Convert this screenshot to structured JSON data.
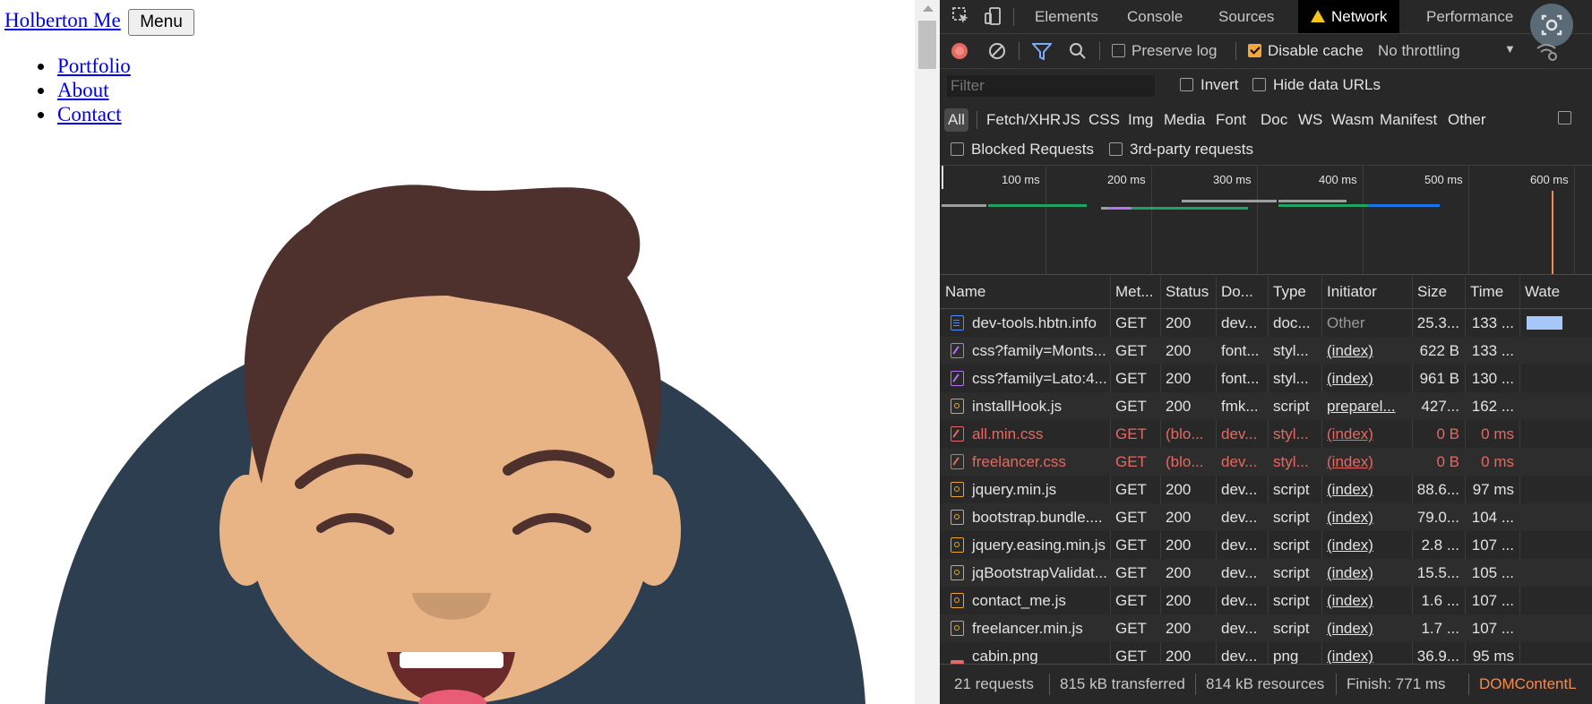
{
  "page": {
    "brand": "Holberton Me",
    "menu_button": "Menu",
    "nav": [
      "Portfolio",
      "About",
      "Contact"
    ]
  },
  "devtools": {
    "tabs": [
      "Elements",
      "Console",
      "Sources",
      "Network",
      "Performance"
    ],
    "active_tab": "Network",
    "toolbar": {
      "preserve_log": "Preserve log",
      "disable_cache": "Disable cache",
      "throttling": "No throttling",
      "preserve_log_checked": false,
      "disable_cache_checked": true
    },
    "filter": {
      "placeholder": "Filter",
      "invert": "Invert",
      "hide_data_urls": "Hide data URLs"
    },
    "type_filters": [
      "All",
      "Fetch/XHR",
      "JS",
      "CSS",
      "Img",
      "Media",
      "Font",
      "Doc",
      "WS",
      "Wasm",
      "Manifest",
      "Other"
    ],
    "blocked_requests": "Blocked Requests",
    "third_party": "3rd-party requests",
    "timeline_ticks": [
      "100 ms",
      "200 ms",
      "300 ms",
      "400 ms",
      "500 ms",
      "600 ms"
    ],
    "columns": [
      "Name",
      "Met...",
      "Status",
      "Do...",
      "Type",
      "Initiator",
      "Size",
      "Time",
      "Wate"
    ],
    "rows": [
      {
        "icon": "doc",
        "name": "dev-tools.hbtn.info",
        "method": "GET",
        "status": "200",
        "domain": "dev...",
        "type": "doc...",
        "initiator": "Other",
        "size": "25.3...",
        "time": "133 ...",
        "err": false,
        "link": false
      },
      {
        "icon": "css",
        "name": "css?family=Monts...",
        "method": "GET",
        "status": "200",
        "domain": "font...",
        "type": "styl...",
        "initiator": "(index)",
        "size": "622 B",
        "time": "133 ...",
        "err": false,
        "link": true
      },
      {
        "icon": "css",
        "name": "css?family=Lato:4...",
        "method": "GET",
        "status": "200",
        "domain": "font...",
        "type": "styl...",
        "initiator": "(index)",
        "size": "961 B",
        "time": "130 ...",
        "err": false,
        "link": true
      },
      {
        "icon": "js",
        "name": "installHook.js",
        "method": "GET",
        "status": "200",
        "domain": "fmk...",
        "type": "script",
        "initiator": "preparel...",
        "size": "427...",
        "time": "162 ...",
        "err": false,
        "link": true
      },
      {
        "icon": "err",
        "name": "all.min.css",
        "method": "GET",
        "status": "(blo...",
        "domain": "dev...",
        "type": "styl...",
        "initiator": "(index)",
        "size": "0 B",
        "time": "0 ms",
        "err": true,
        "link": true
      },
      {
        "icon": "err",
        "name": "freelancer.css",
        "method": "GET",
        "status": "(blo...",
        "domain": "dev...",
        "type": "styl...",
        "initiator": "(index)",
        "size": "0 B",
        "time": "0 ms",
        "err": true,
        "link": true
      },
      {
        "icon": "js",
        "name": "jquery.min.js",
        "method": "GET",
        "status": "200",
        "domain": "dev...",
        "type": "script",
        "initiator": "(index)",
        "size": "88.6...",
        "time": "97 ms",
        "err": false,
        "link": true
      },
      {
        "icon": "js",
        "name": "bootstrap.bundle....",
        "method": "GET",
        "status": "200",
        "domain": "dev...",
        "type": "script",
        "initiator": "(index)",
        "size": "79.0...",
        "time": "104 ...",
        "err": false,
        "link": true
      },
      {
        "icon": "js",
        "name": "jquery.easing.min.js",
        "method": "GET",
        "status": "200",
        "domain": "dev...",
        "type": "script",
        "initiator": "(index)",
        "size": "2.8 ...",
        "time": "107 ...",
        "err": false,
        "link": true
      },
      {
        "icon": "js",
        "name": "jqBootstrapValidat...",
        "method": "GET",
        "status": "200",
        "domain": "dev...",
        "type": "script",
        "initiator": "(index)",
        "size": "15.5...",
        "time": "105 ...",
        "err": false,
        "link": true
      },
      {
        "icon": "js",
        "name": "contact_me.js",
        "method": "GET",
        "status": "200",
        "domain": "dev...",
        "type": "script",
        "initiator": "(index)",
        "size": "1.6 ...",
        "time": "107 ...",
        "err": false,
        "link": true
      },
      {
        "icon": "js",
        "name": "freelancer.min.js",
        "method": "GET",
        "status": "200",
        "domain": "dev...",
        "type": "script",
        "initiator": "(index)",
        "size": "1.7 ...",
        "time": "107 ...",
        "err": false,
        "link": true
      },
      {
        "icon": "img",
        "name": "cabin.png",
        "method": "GET",
        "status": "200",
        "domain": "dev...",
        "type": "png",
        "initiator": "(index)",
        "size": "36.9...",
        "time": "95 ms",
        "err": false,
        "link": true
      }
    ],
    "status_bar": {
      "requests": "21 requests",
      "transferred": "815 kB transferred",
      "resources": "814 kB resources",
      "finish": "Finish: 771 ms",
      "dom": "DOMContentL"
    },
    "colors": {
      "accent": "#f2a63b",
      "error": "#e46962",
      "dom_content": "#f28b54"
    }
  }
}
